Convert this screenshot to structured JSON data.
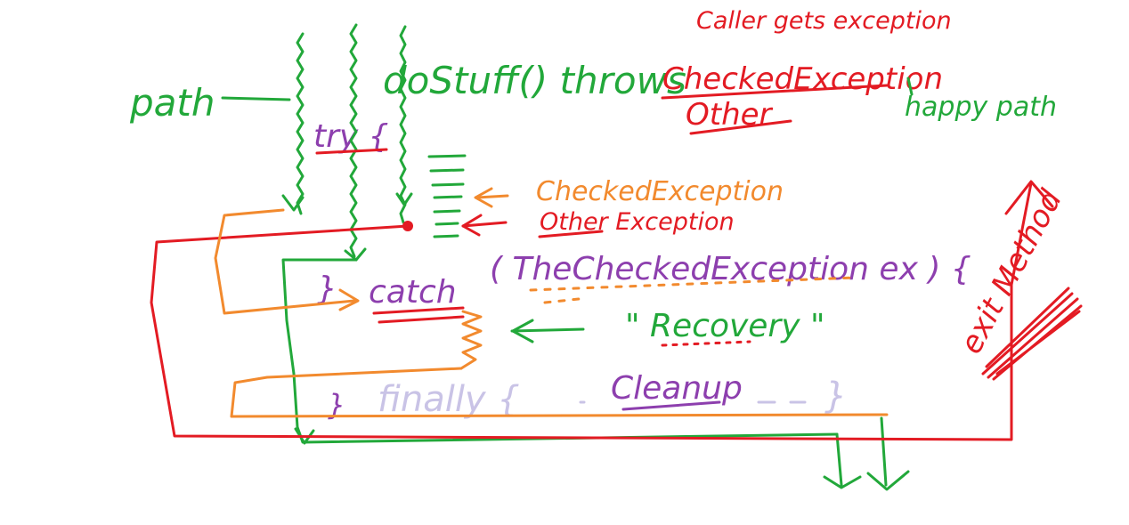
{
  "colors": {
    "green": "#22a83a",
    "red": "#e31b23",
    "orange": "#f28a2e",
    "purple": "#8d3fae",
    "lavender": "#c9c3e6",
    "background": "#ffffff"
  },
  "labels": {
    "caller_gets_exception": "Caller gets exception",
    "path": "path",
    "do_stuff": "doStuff() throws",
    "checked_exception_top": "CheckedException",
    "other_top": "Other",
    "happy_path": "happy path",
    "try": "try {",
    "checked_exception_mid": "CheckedException",
    "other_exception": "Other Exception",
    "catch_close": "}",
    "catch": "catch",
    "catch_args": "( TheCheckedException ex ) {",
    "recovery": "\" Recovery \"",
    "finally_close": "}",
    "finally": "finally {",
    "cleanup": "Cleanup",
    "finally_end": "}",
    "exit_method": "exit Method"
  }
}
